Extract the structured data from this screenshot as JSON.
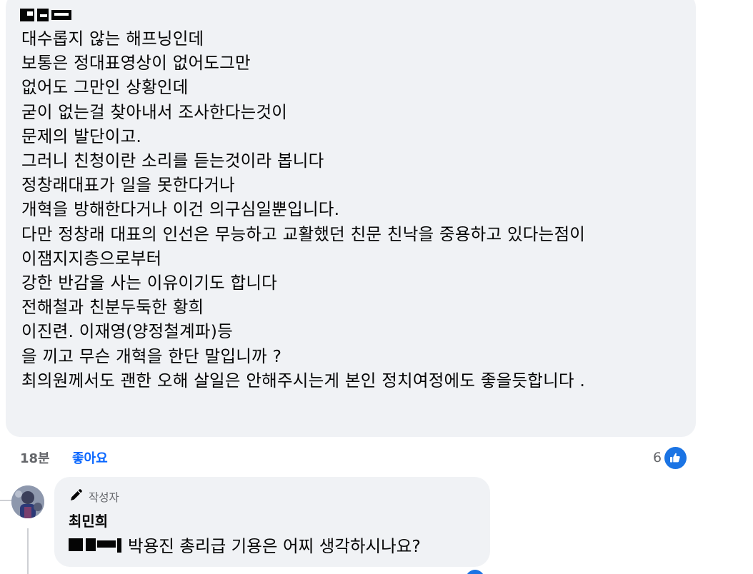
{
  "comment": {
    "lines": [
      "대수롭지 않는 해프닝인데",
      "보통은 정대표영상이 없어도그만",
      "없어도 그만인 상황인데",
      "굳이 없는걸 찾아내서 조사한다는것이",
      "문제의 발단이고.",
      "그러니 친청이란 소리를 듣는것이라 봅니다",
      "정창래대표가 일을 못한다거나",
      "개혁을 방해한다거나 이건 의구심일뿐입니다.",
      "다만 정창래 대표의 인선은 무능하고 교활했던 친문 친낙을 중용하고 있다는점이",
      "이잼지지층으로부터",
      "강한 반감을 사는 이유이기도 합니다",
      "전해철과 친분두둑한 황희",
      "이진련. 이재영(양정철계파)등",
      "을 끼고 무슨 개혁을 한단 말입니까 ?",
      "최의원께서도 괜한 오해 살일은 안해주시는게 본인 정치여정에도 좋을듯합니다 ."
    ],
    "time": "18분",
    "like_label": "좋아요",
    "reaction_count": "6"
  },
  "reply": {
    "badge": "작성자",
    "author": "최민희",
    "text": "박용진 총리급 기용은 어찌 생각하시나요?"
  },
  "colors": {
    "bubble": "#f0f2f5",
    "link": "#0866ff",
    "like_icon": "#1b74e4",
    "meta": "#65676b"
  },
  "icons": {
    "reaction": "thumbs-up-icon",
    "badge": "pen-icon"
  }
}
